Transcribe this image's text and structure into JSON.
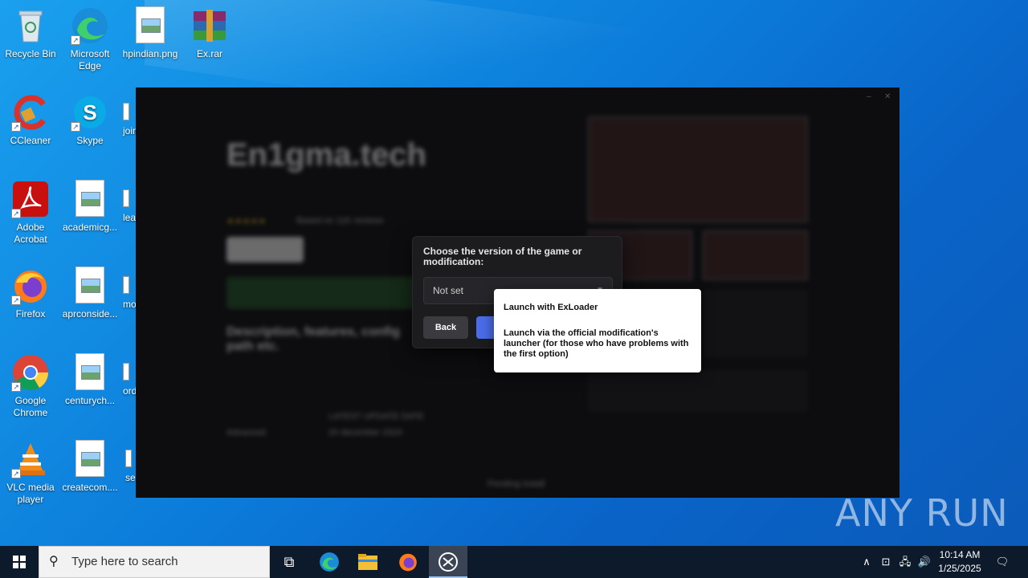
{
  "desktop": {
    "icons": [
      {
        "label": "Recycle Bin"
      },
      {
        "label": "Microsoft Edge"
      },
      {
        "label": "hpindian.png"
      },
      {
        "label": "Ex.rar"
      },
      {
        "label": "CCleaner"
      },
      {
        "label": "Skype"
      },
      {
        "label": "Adobe Acrobat"
      },
      {
        "label": "academicg..."
      },
      {
        "label": "Firefox"
      },
      {
        "label": "aprconside..."
      },
      {
        "label": "Google Chrome"
      },
      {
        "label": "centurych..."
      },
      {
        "label": "VLC media player"
      },
      {
        "label": "createcom...."
      }
    ],
    "partial_icons": [
      "join",
      "lea",
      "mo",
      "ord",
      "se"
    ]
  },
  "app": {
    "title": "En1gma.tech",
    "background_heading": "Description, features, config path etc.",
    "background_rating": "Based on 11K reviews",
    "background_update_label": "LATEST UPDATE DATE",
    "background_update_value": "20 december 2024",
    "background_mode": "Advanced",
    "background_footer": "Pending install"
  },
  "dialog": {
    "title": "Choose the version of the game or modification:",
    "select_value": "Not set",
    "back_label": "Back"
  },
  "dropdown": {
    "options": [
      {
        "label": "Launch with ExLoader"
      },
      {
        "label": "Launch via the official modification's launcher (for those who have problems with the first option)"
      }
    ]
  },
  "watermark": "ANY RUN",
  "taskbar": {
    "search_placeholder": "Type here to search",
    "time": "10:14 AM",
    "date": "1/25/2025"
  },
  "colors": {
    "primary_button": "#4a6ce8",
    "dialog_bg": "#1c1c1f",
    "taskbar_bg": "#0d1a2b"
  }
}
